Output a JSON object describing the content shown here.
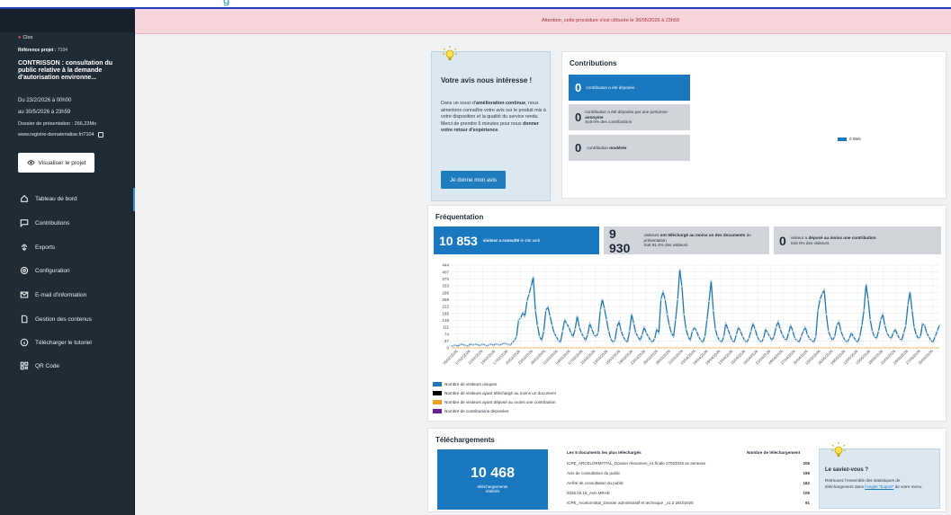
{
  "topbar": {
    "text": "g"
  },
  "banner": {
    "text": "Attention, cette procédure s'est clôturée le 30/05/2026 à 23h59"
  },
  "sidebar": {
    "status": "Clos",
    "reference_label": "Référence projet :",
    "reference_value": "7104",
    "title": "CONTRISSON : consultation du public relative à la demande d'autorisation environne...",
    "date_from": "Du 23/2/2026 à 00h00",
    "date_to": "au 30/5/2026 à 23h59",
    "dossier": "Dossier de présentation : 266,23Mo",
    "link": "www.registre-dematerialise.fr/7104",
    "visualize_button": "Visualiser le projet",
    "nav": [
      {
        "label": "Tableau de bord",
        "icon": "home-icon"
      },
      {
        "label": "Contributions",
        "icon": "chat-icon"
      },
      {
        "label": "Exports",
        "icon": "export-icon"
      },
      {
        "label": "Configuration",
        "icon": "gear-icon"
      },
      {
        "label": "E-mail d'information",
        "icon": "mail-icon"
      },
      {
        "label": "Gestion des contenus",
        "icon": "document-icon"
      },
      {
        "label": "Télécharger le tutoriel",
        "icon": "info-icon"
      },
      {
        "label": "QR Code",
        "icon": "qr-icon"
      }
    ]
  },
  "feedback": {
    "title": "Votre avis nous intéresse !",
    "text_1": "Dans un souci d'",
    "text_bold_1": "amélioration continue",
    "text_2": ", nous aimerions connaître votre avis sur le produit mis à votre disposition et la qualité du service rendu. Merci de prendre 5 minutes pour nous ",
    "text_bold_2": "donner votre retour d'expérience",
    "text_3": ".",
    "button": "Je donne mon avis"
  },
  "contributions": {
    "title": "Contributions",
    "tile1_num": "0",
    "tile1_label": "contribution a été déposée",
    "tile2_num": "0",
    "tile2_label_a": "contribution a été déposée par une personne",
    "tile2_label_b": "anonyme",
    "tile2_label_c": "Soit 0% des contributions",
    "tile3_num": "0",
    "tile3_label_a": "contribution",
    "tile3_label_b": "modérée",
    "legend": "0 Web",
    "legend_color": "#1a78c0"
  },
  "frequentation": {
    "title": "Fréquentation",
    "tile1_num": "10 853",
    "tile1_label_a": "visiteur a consulté",
    "tile1_label_b": "le site web",
    "tile2_num": "9 930",
    "tile2_label_a": "visiteurs ",
    "tile2_label_b": "ont téléchargé au moins un des documents",
    "tile2_label_c": " de présentation",
    "tile2_label_d": "Soit 91.4% des visiteurs",
    "tile3_num": "0",
    "tile3_label_a": "visiteur a ",
    "tile3_label_b": "déposé au moins une contribution",
    "tile3_label_c": "Soit 0% des visiteurs",
    "legend": [
      {
        "label": "Nombre de visiteurs uniques",
        "color": "#1f77b4"
      },
      {
        "label": "Nombre de visiteurs ayant téléchargé au moins un document",
        "color": "#000000"
      },
      {
        "label": "Nombre de visiteurs ayant déposé au moins une contribution",
        "color": "#f0a020"
      },
      {
        "label": "Nombre de contributions déposées",
        "color": "#6a1b9a"
      }
    ]
  },
  "chart_data": {
    "type": "line",
    "yticks": [
      444,
      407,
      370,
      333,
      296,
      259,
      222,
      185,
      148,
      111,
      74,
      37,
      0
    ],
    "ylim": [
      0,
      444
    ],
    "x_tick_labels": [
      "05/02/2026",
      "07/02/2026",
      "11/02/2026",
      "14/02/2026",
      "17/02/2026",
      "20/02/2026",
      "23/02/2026",
      "26/02/2026",
      "01/03/2026",
      "04/03/2026",
      "07/03/2026",
      "10/03/2026",
      "13/03/2026",
      "16/03/2026",
      "19/03/2026",
      "22/03/2026",
      "25/03/2026",
      "28/03/2026",
      "31/03/2026",
      "03/04/2026",
      "06/04/2026",
      "09/04/2026",
      "12/04/2026",
      "15/04/2026",
      "18/04/2026",
      "21/04/2026",
      "24/04/2026",
      "27/04/2026",
      "30/04/2026",
      "03/05/2026",
      "06/05/2026",
      "09/05/2026",
      "12/05/2026",
      "15/05/2026",
      "18/05/2026",
      "21/05/2026",
      "24/05/2026",
      "27/05/2026",
      "30/05/2026"
    ],
    "series": [
      {
        "name": "Nombre de visiteurs uniques",
        "color": "#1f77b4",
        "values": [
          10,
          12,
          15,
          8,
          18,
          20,
          14,
          12,
          10,
          22,
          15,
          18,
          20,
          12,
          16,
          20,
          14,
          10,
          18,
          20,
          12,
          22,
          18,
          15,
          20,
          25,
          22,
          18,
          15,
          28,
          40,
          60,
          150,
          160,
          190,
          170,
          250,
          290,
          330,
          380,
          200,
          120,
          60,
          40,
          90,
          200,
          220,
          170,
          120,
          80,
          60,
          40,
          30,
          90,
          150,
          130,
          110,
          80,
          60,
          100,
          170,
          110,
          80,
          60,
          40,
          70,
          130,
          100,
          70,
          60,
          80,
          200,
          260,
          210,
          150,
          90,
          50,
          30,
          40,
          110,
          140,
          90,
          60,
          40,
          30,
          90,
          180,
          130,
          80,
          60,
          40,
          70,
          110,
          80,
          60,
          40,
          30,
          50,
          100,
          80,
          260,
          300,
          260,
          180,
          120,
          80,
          60,
          150,
          260,
          420,
          330,
          180,
          100,
          60,
          40,
          90,
          110,
          90,
          60,
          40,
          30,
          60,
          150,
          250,
          360,
          200,
          100,
          60,
          40,
          30,
          60,
          130,
          100,
          70,
          40,
          30,
          70,
          110,
          90,
          60,
          40,
          30,
          50,
          90,
          130,
          100,
          60,
          40,
          30,
          50,
          100,
          80,
          60,
          40,
          60,
          110,
          140,
          100,
          70,
          50,
          40,
          80,
          120,
          90,
          50,
          40,
          30,
          60,
          90,
          110,
          70,
          50,
          40,
          30,
          60,
          200,
          260,
          290,
          310,
          180,
          90,
          60,
          40,
          60,
          120,
          140,
          90,
          60,
          40,
          30,
          50,
          80,
          60,
          40,
          30,
          60,
          120,
          200,
          340,
          260,
          150,
          90,
          60,
          50,
          90,
          150,
          180,
          120,
          80,
          60,
          50,
          80,
          100,
          70,
          50,
          40,
          80,
          120,
          230,
          300,
          200,
          110,
          70,
          50,
          60,
          130,
          120,
          80,
          60,
          40,
          30,
          60,
          90,
          120
        ]
      },
      {
        "name": "Nombre de visiteurs ayant téléchargé au moins un document",
        "color": "#000000",
        "values": []
      },
      {
        "name": "Nombre de visiteurs ayant déposé au moins une contribution",
        "color": "#f0a020",
        "values": [
          0
        ]
      },
      {
        "name": "Nombre de contributions déposées",
        "color": "#6a1b9a",
        "values": [
          0
        ]
      }
    ]
  },
  "downloads": {
    "title": "Téléchargements",
    "total": "10 468",
    "total_label_a": "téléchargements",
    "total_label_b": "réalisés",
    "col_doc": "Les 5 documents les plus téléchargés",
    "col_count": "Nombre de téléchargement",
    "rows": [
      {
        "doc": "ICPE_ARCELORMITTAL_Dossier réexamen_v1 finale 27022025 av annexes",
        "count": "209"
      },
      {
        "doc": "Avis de consultation du public",
        "count": "195"
      },
      {
        "doc": "Arrêté de consultation du public",
        "count": "182"
      },
      {
        "doc": "2026.02.18_Avis MRAE",
        "count": "105"
      },
      {
        "doc": "ICPE_Arcelormittal_Dossier administratif et technique _v1.2 28102025",
        "count": "91"
      }
    ],
    "saviez_title": "Le saviez-vous ?",
    "saviez_text_a": "Retrouvez l'ensemble des statistiques de téléchargement dans ",
    "saviez_link": "l'onglet \"Export\"",
    "saviez_text_b": " de votre menu."
  }
}
